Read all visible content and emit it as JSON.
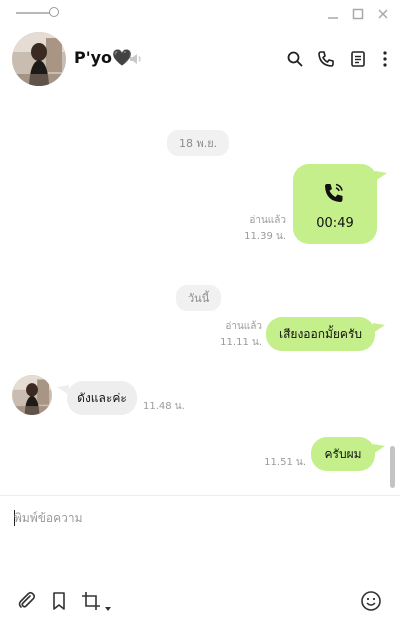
{
  "header": {
    "contact_name": "P'yo🖤"
  },
  "messages": {
    "date1": "18 พ.ย.",
    "call": {
      "read_label": "อ่านแล้ว",
      "time": "11.39 น.",
      "duration": "00:49"
    },
    "date2": "วันนี้",
    "out1": {
      "text": "เสียงออกมั้ยครับ",
      "read_label": "อ่านแล้ว",
      "time": "11.11 น."
    },
    "in1": {
      "text": "ดังและค่ะ",
      "time": "11.48 น."
    },
    "out2": {
      "text": "ครับผม",
      "time": "11.51 น."
    }
  },
  "composer": {
    "placeholder": "พิมพ์ข้อความ"
  },
  "colors": {
    "outgoing_bubble": "#c4ef8a",
    "incoming_bubble": "#eeeeee",
    "date_chip": "#f1f1f1"
  }
}
